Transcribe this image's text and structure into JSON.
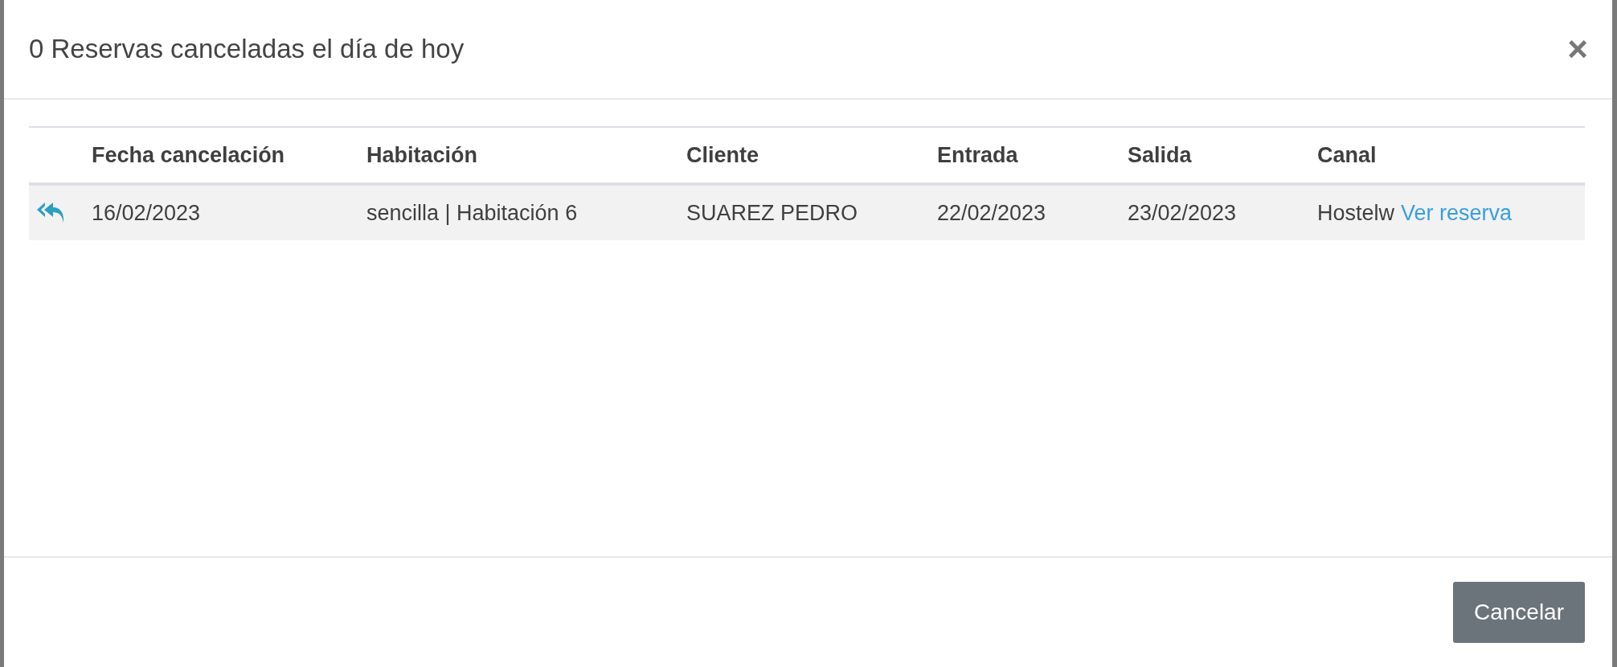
{
  "modal": {
    "title": "0 Reservas canceladas el día de hoy",
    "close": "×"
  },
  "table": {
    "columns": [
      "Fecha cancelación",
      "Habitación",
      "Cliente",
      "Entrada",
      "Salida",
      "Canal"
    ],
    "rows": [
      {
        "cancelled_on": "16/02/2023",
        "room": "sencilla | Habitación 6",
        "client": "SUAREZ PEDRO",
        "check_in": "22/02/2023",
        "check_out": "23/02/2023",
        "channel": "Hostelw",
        "link": "Ver reserva"
      }
    ]
  },
  "footer": {
    "button": "Cancelar"
  }
}
